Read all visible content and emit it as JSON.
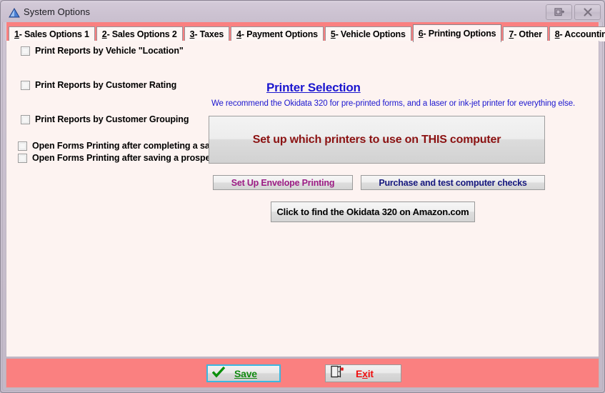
{
  "window": {
    "title": "System Options",
    "icon": "blue-triangle-icon",
    "restore_icon": "restore-window-icon",
    "close_icon": "close-window-icon",
    "titlebar_color": "#cdc3d2",
    "accent_color": "#fa8080"
  },
  "tabs": [
    {
      "key": "1",
      "label": " - Sales Options 1",
      "active": false
    },
    {
      "key": "2",
      "label": " - Sales Options 2",
      "active": false
    },
    {
      "key": "3",
      "label": " - Taxes",
      "active": false
    },
    {
      "key": "4",
      "label": " - Payment Options",
      "active": false
    },
    {
      "key": "5",
      "label": " - Vehicle Options",
      "active": false
    },
    {
      "key": "6",
      "label": " - Printing Options",
      "active": true
    },
    {
      "key": "7",
      "label": " - Other",
      "active": false
    },
    {
      "key": "8",
      "label": " - Accounting",
      "active": false
    }
  ],
  "main": {
    "checkboxes": [
      {
        "label": "Print Reports by Vehicle \"Location\"",
        "checked": false
      },
      {
        "label": "Print Reports by Customer Rating",
        "checked": false
      },
      {
        "label": "Print Reports by Customer Grouping",
        "checked": false
      },
      {
        "label": "Open Forms Printing after completing a sale.",
        "checked": false
      },
      {
        "label": "Open Forms Printing after saving a prospect.",
        "checked": false
      }
    ],
    "printer_heading": "Printer Selection",
    "printer_heading_color": "#1b16cf",
    "recommendation": "We recommend the Okidata 320 for pre-printed forms, and a laser or ink-jet printer for everything else.",
    "setup_printers_button": "Set up which printers to use on THIS computer",
    "setup_printers_color": "#8b1212",
    "envelope_button": "Set Up Envelope Printing",
    "envelope_color": "#9c1c84",
    "checks_button": "Purchase and test computer checks",
    "checks_color": "#16187e",
    "amazon_button": "Click to find the Okidata 320 on Amazon.com"
  },
  "footer": {
    "save_label": "Save",
    "save_accel": "S",
    "save_color": "#118a11",
    "save_icon": "green-checkmark-icon",
    "exit_label_before": "E",
    "exit_accel": "x",
    "exit_label_after": "it",
    "exit_color": "#ef1010",
    "exit_icon": "door-exit-icon"
  }
}
